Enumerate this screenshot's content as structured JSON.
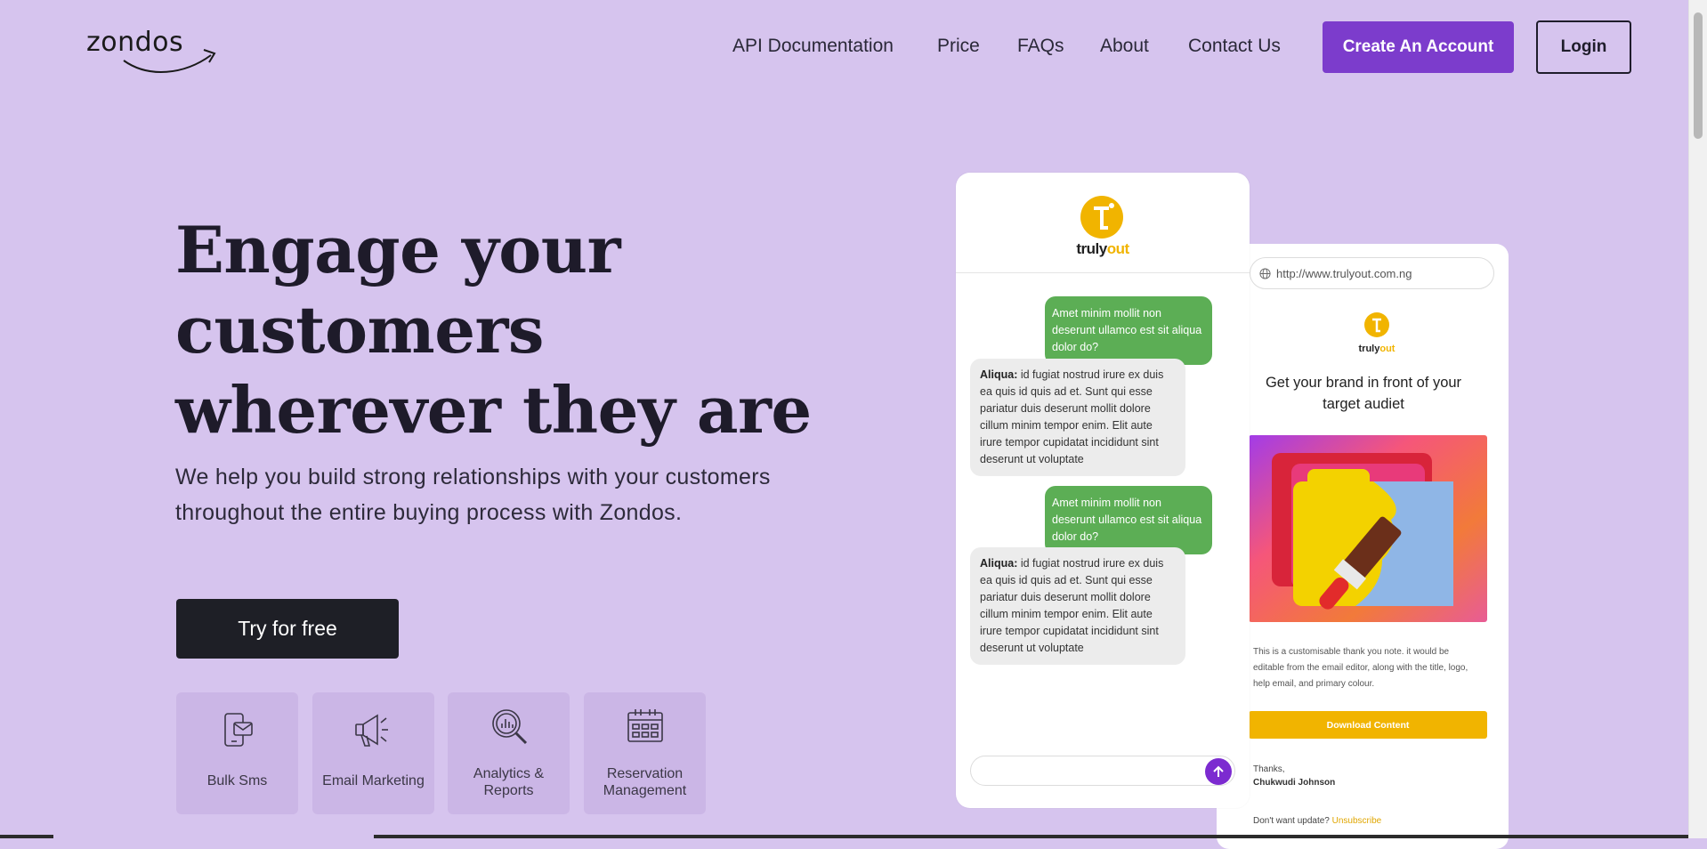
{
  "header": {
    "logo_text": "zondos",
    "nav": [
      {
        "label": "API Documentation"
      },
      {
        "label": "Price"
      },
      {
        "label": "FAQs"
      },
      {
        "label": "About"
      },
      {
        "label": "Contact Us"
      }
    ],
    "create_account_label": "Create An Account",
    "login_label": "Login"
  },
  "hero": {
    "title": "Engage your customers wherever they are",
    "subtitle": "We help you build strong relationships with your customers throughout the entire buying process with Zondos.",
    "cta_label": "Try for free"
  },
  "features": [
    {
      "label": "Bulk Sms",
      "icon": "sms-phone-icon"
    },
    {
      "label": "Email Marketing",
      "icon": "megaphone-icon"
    },
    {
      "label": "Analytics & Reports",
      "icon": "analytics-magnifier-icon"
    },
    {
      "label": "Reservation Management",
      "icon": "calendar-icon"
    }
  ],
  "chat": {
    "brand": "trulyout",
    "messages": [
      {
        "direction": "out",
        "text": "Amet minim mollit non deserunt ullamco est sit aliqua dolor do?"
      },
      {
        "direction": "in",
        "sender": "Aliqua:",
        "text": " id fugiat nostrud irure ex duis ea quis id quis ad et. Sunt qui esse pariatur duis deserunt mollit dolore cillum minim tempor enim. Elit aute irure tempor cupidatat incididunt sint deserunt ut voluptate"
      },
      {
        "direction": "out",
        "text": "Amet minim mollit non deserunt ullamco est sit aliqua dolor do?"
      },
      {
        "direction": "in",
        "sender": "Aliqua:",
        "text": " id fugiat nostrud irure ex duis ea quis id quis ad et. Sunt qui esse pariatur duis deserunt mollit dolore cillum minim tempor enim. Elit aute irure tempor cupidatat incididunt sint deserunt ut voluptate"
      }
    ],
    "input_placeholder": "",
    "send_icon": "arrow-up-icon"
  },
  "email": {
    "url": "http://www.trulyout.com.ng",
    "brand": "trulyout",
    "headline": "Get your brand in front of your target audiet",
    "body": "This is a customisable thank you note. it would be editable from the email editor, along with the title, logo, help email, and  primary colour.",
    "download_label": "Download Content",
    "thanks": "Thanks,",
    "signature": "Chukwudi Johnson",
    "unsubscribe_prefix": "Don't want update?",
    "unsubscribe_link": "Unsubscribe"
  },
  "colors": {
    "background": "#d6c4ee",
    "accent": "#7c3ccc",
    "cta_dark": "#1e1f26",
    "chat_out": "#5cae55",
    "brand_yellow": "#f1b400"
  }
}
